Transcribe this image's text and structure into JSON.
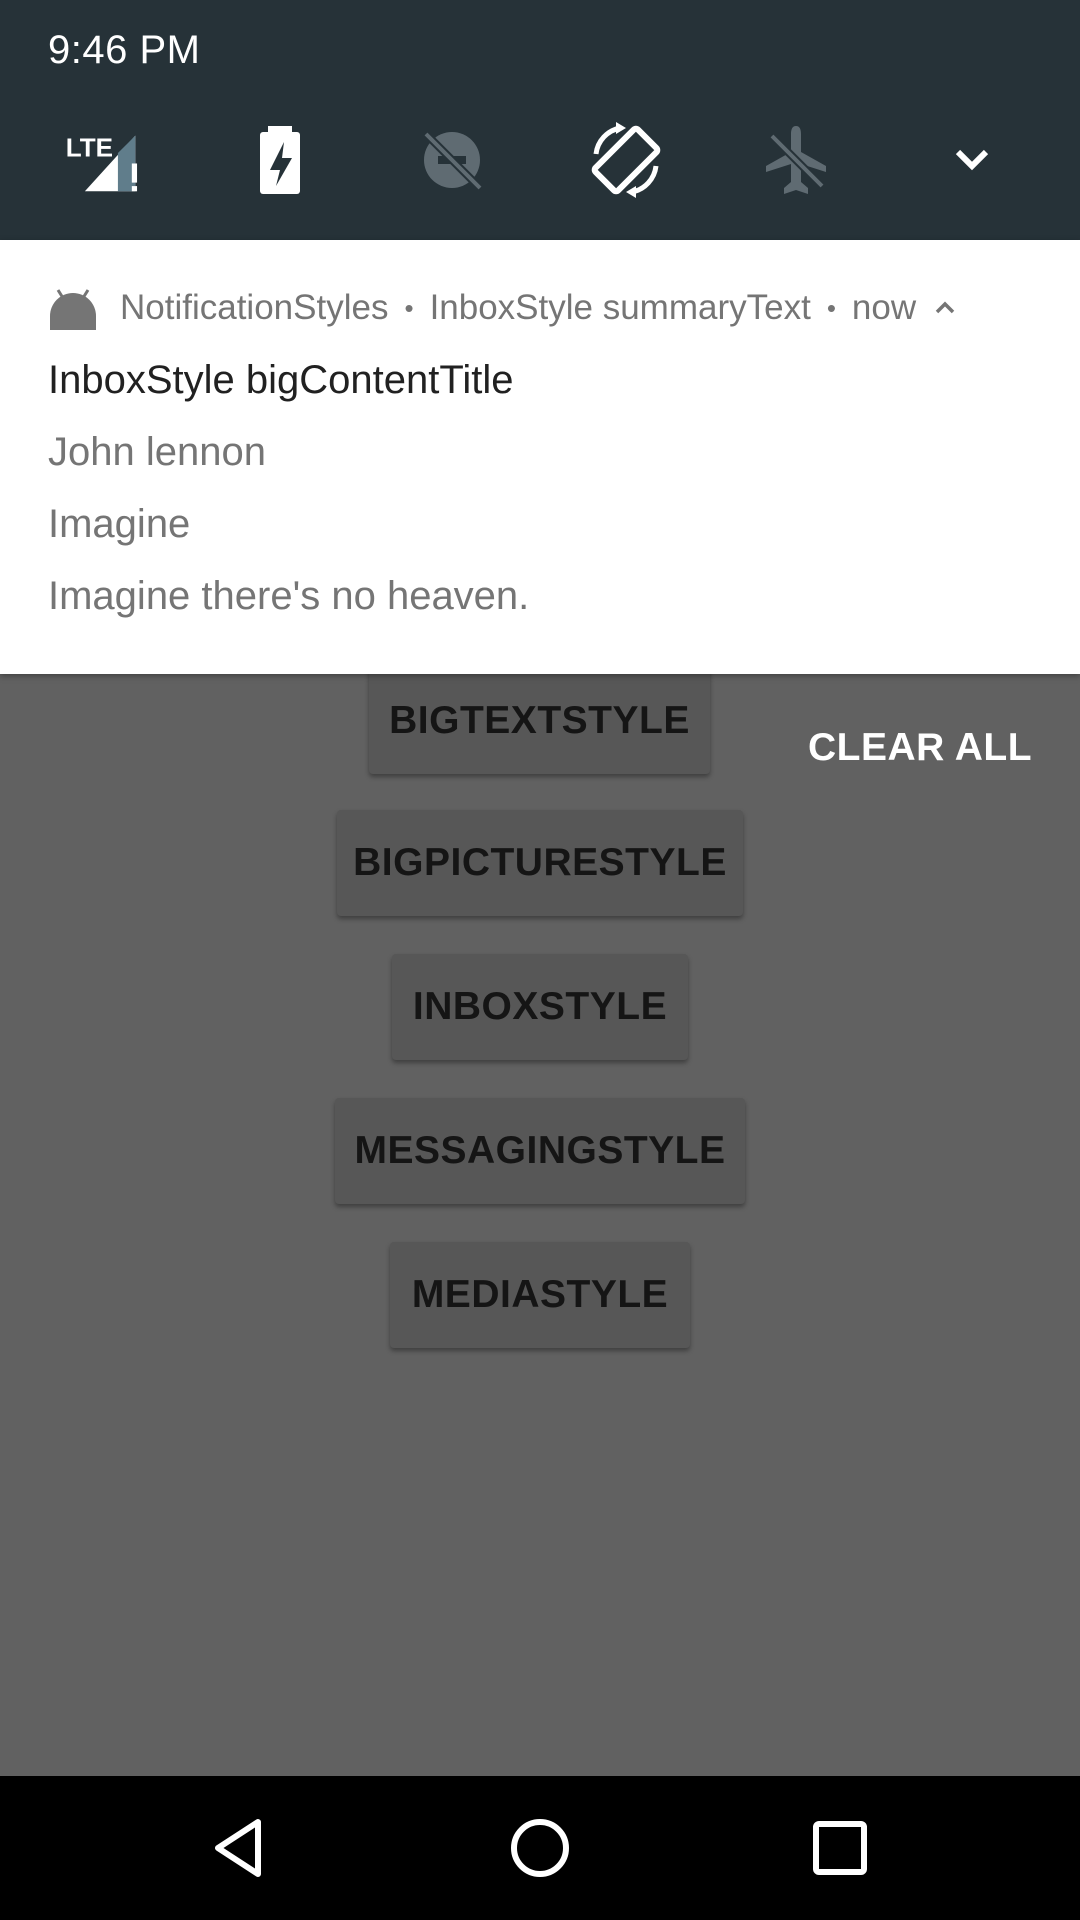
{
  "status": {
    "time": "9:46 PM"
  },
  "quick_settings": {
    "tiles": [
      {
        "icon": "lte-signal-icon",
        "label": "LTE"
      },
      {
        "icon": "battery-saver-icon"
      },
      {
        "icon": "do-not-disturb-off-icon"
      },
      {
        "icon": "auto-rotate-icon"
      },
      {
        "icon": "airplane-mode-icon"
      },
      {
        "icon": "expand-chevron-icon"
      }
    ],
    "lte_label": "LTE"
  },
  "notification": {
    "app_name": "NotificationStyles",
    "separator": "•",
    "summary_text": "InboxStyle summaryText",
    "time": "now",
    "title": "InboxStyle bigContentTitle",
    "lines": [
      "John lennon",
      "Imagine",
      "Imagine there's no heaven."
    ]
  },
  "app": {
    "buttons": [
      "BIGTEXTSTYLE",
      "BIGPICTURESTYLE",
      "INBOXSTYLE",
      "MESSAGINGSTYLE",
      "MEDIASTYLE"
    ],
    "clear_all": "CLEAR ALL"
  },
  "colors": {
    "quick_settings_bg": "#263238",
    "scrim_bg": "#616161",
    "notification_bg": "#ffffff",
    "navbar_bg": "#000000"
  }
}
